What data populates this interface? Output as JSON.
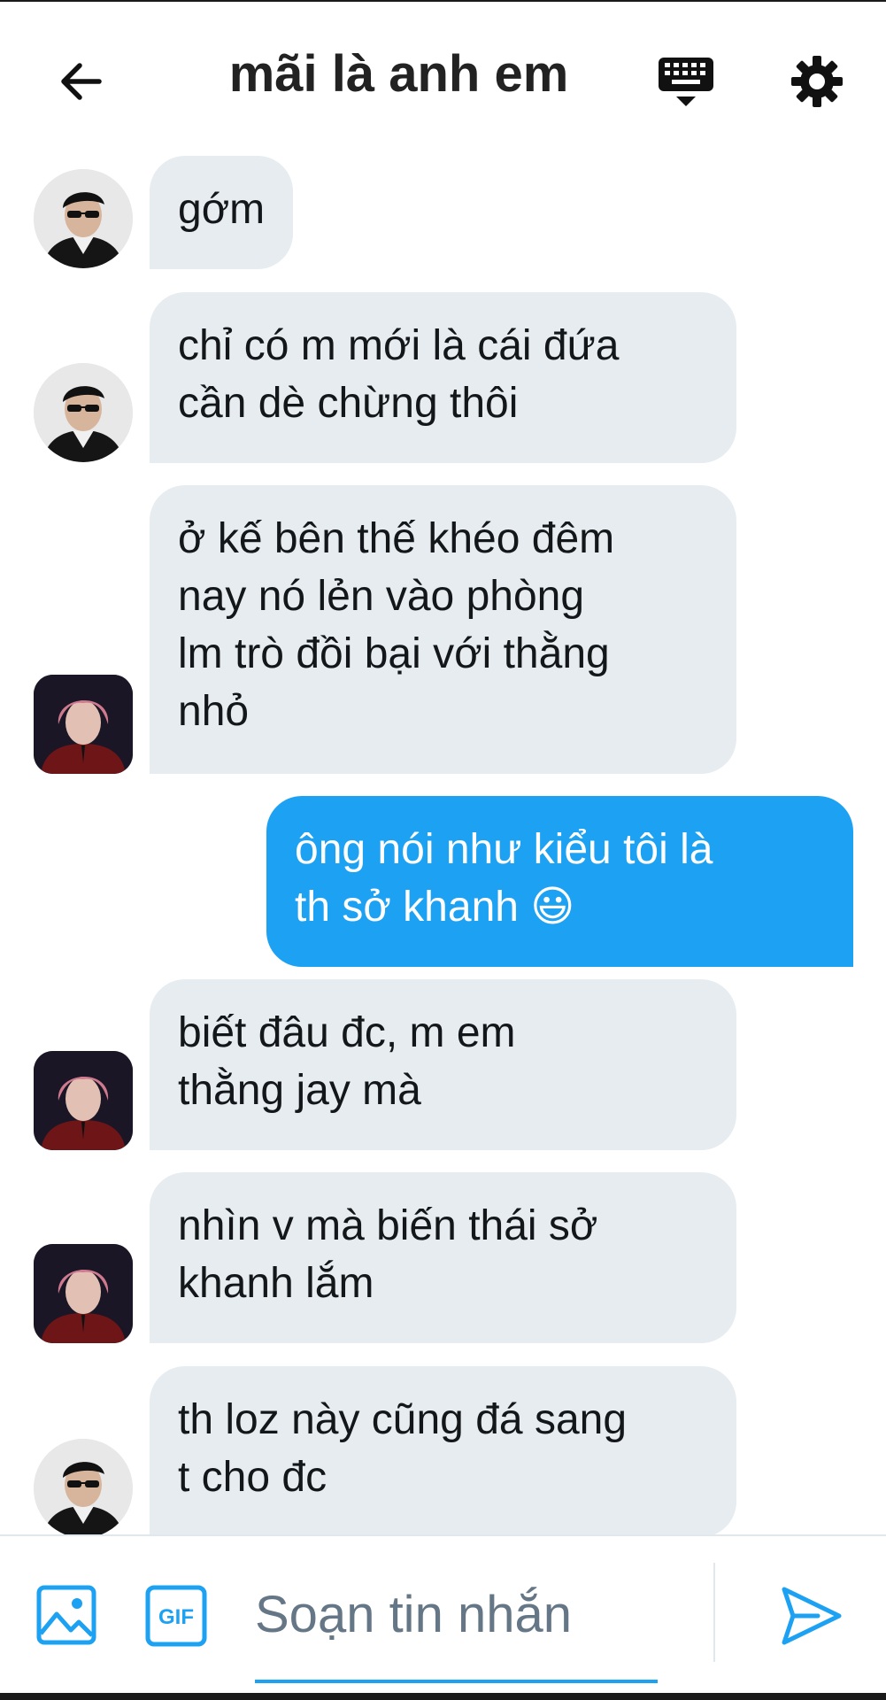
{
  "header": {
    "title": "mãi là anh em",
    "back_icon": "arrow-left-icon",
    "keyboard_icon": "keyboard-icon",
    "settings_icon": "gear-icon"
  },
  "colors": {
    "accent": "#1da1f2",
    "incoming_bubble": "#e6ecf0",
    "text": "#14171a",
    "placeholder": "#657786"
  },
  "messages": [
    {
      "direction": "in",
      "sender_avatar": "avatar-sunglasses",
      "text": "gớm"
    },
    {
      "direction": "in",
      "sender_avatar": "avatar-sunglasses",
      "text": "chỉ có m mới là cái đứa\ncần dè chừng thôi"
    },
    {
      "direction": "in",
      "sender_avatar": "avatar-pink-hair",
      "text": "ở kế bên thế khéo đêm\nnay nó lẻn vào phòng\nlm trò đồi bại với thằng\nnhỏ"
    },
    {
      "direction": "out",
      "text": "ông nói như kiểu tôi là\nth sở khanh 😃"
    },
    {
      "direction": "in",
      "sender_avatar": "avatar-pink-hair",
      "text": "biết đâu đc, m em\nthằng jay mà"
    },
    {
      "direction": "in",
      "sender_avatar": "avatar-pink-hair",
      "text": "nhìn v mà biến thái sở\nkhanh lắm"
    },
    {
      "direction": "in",
      "sender_avatar": "avatar-sunglasses",
      "text": "th loz này cũng đá sang\nt cho đc"
    }
  ],
  "composer": {
    "placeholder": "Soạn tin nhắn",
    "value": "",
    "gif_label": "GIF",
    "image_icon": "image-icon",
    "send_icon": "send-icon"
  }
}
